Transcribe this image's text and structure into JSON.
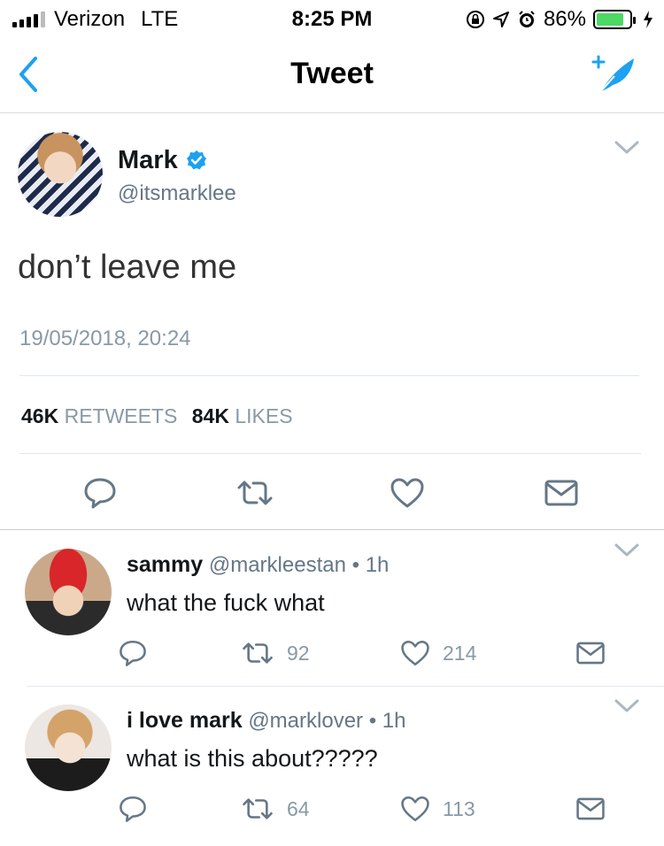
{
  "status_bar": {
    "carrier": "Verizon",
    "network": "LTE",
    "time": "8:25 PM",
    "battery": "86%"
  },
  "nav": {
    "title": "Tweet",
    "back_icon": "chevron-left-icon",
    "compose_icon": "compose-tweet-icon"
  },
  "tweet": {
    "author_name": "Mark",
    "author_handle": "@itsmarklee",
    "text": "don’t leave me",
    "date": "19/05/2018, 20:24",
    "retweets_count": "46K",
    "retweets_label": "RETWEETS",
    "likes_count": "84K",
    "likes_label": "LIKES"
  },
  "replies": [
    {
      "name": "sammy",
      "handle": "@markleestan",
      "time": "1h",
      "text": "what the fuck what",
      "retweets": "92",
      "likes": "214"
    },
    {
      "name": "i love mark",
      "handle": "@marklover",
      "time": "1h",
      "text": "what is this about?????",
      "retweets": "64",
      "likes": "113"
    }
  ],
  "colors": {
    "accent": "#1da1f2",
    "battery": "#4cd964",
    "secondary_text": "#657786"
  }
}
